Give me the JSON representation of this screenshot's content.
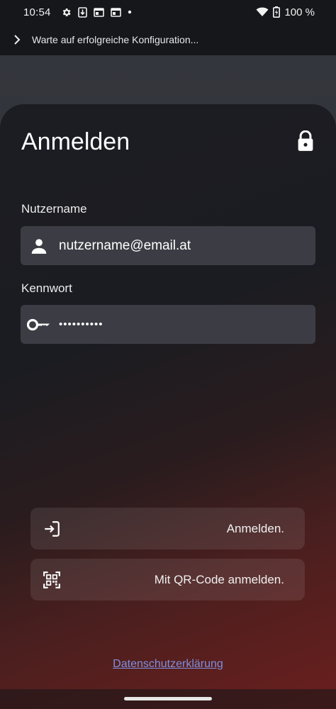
{
  "status_bar": {
    "time": "10:54",
    "battery": "100 %",
    "icons": [
      "gear-icon",
      "download-icon",
      "window-icon",
      "window-icon",
      "dot-icon",
      "wifi-icon",
      "battery-charging-icon"
    ]
  },
  "config_bar": {
    "text": "Warte auf erfolgreiche Konfiguration..."
  },
  "login": {
    "title": "Anmelden",
    "username_label": "Nutzername",
    "username_value": "nutzername@email.at",
    "password_label": "Kennwort",
    "password_value": "••••••••••",
    "login_button": "Anmelden.",
    "qr_button": "Mit QR-Code anmelden.",
    "privacy_link": "Datenschutzerklärung"
  },
  "colors": {
    "field_bg": "#3c3d44",
    "link": "#7f8fe0",
    "gradient_end": "#6a1f1d"
  }
}
